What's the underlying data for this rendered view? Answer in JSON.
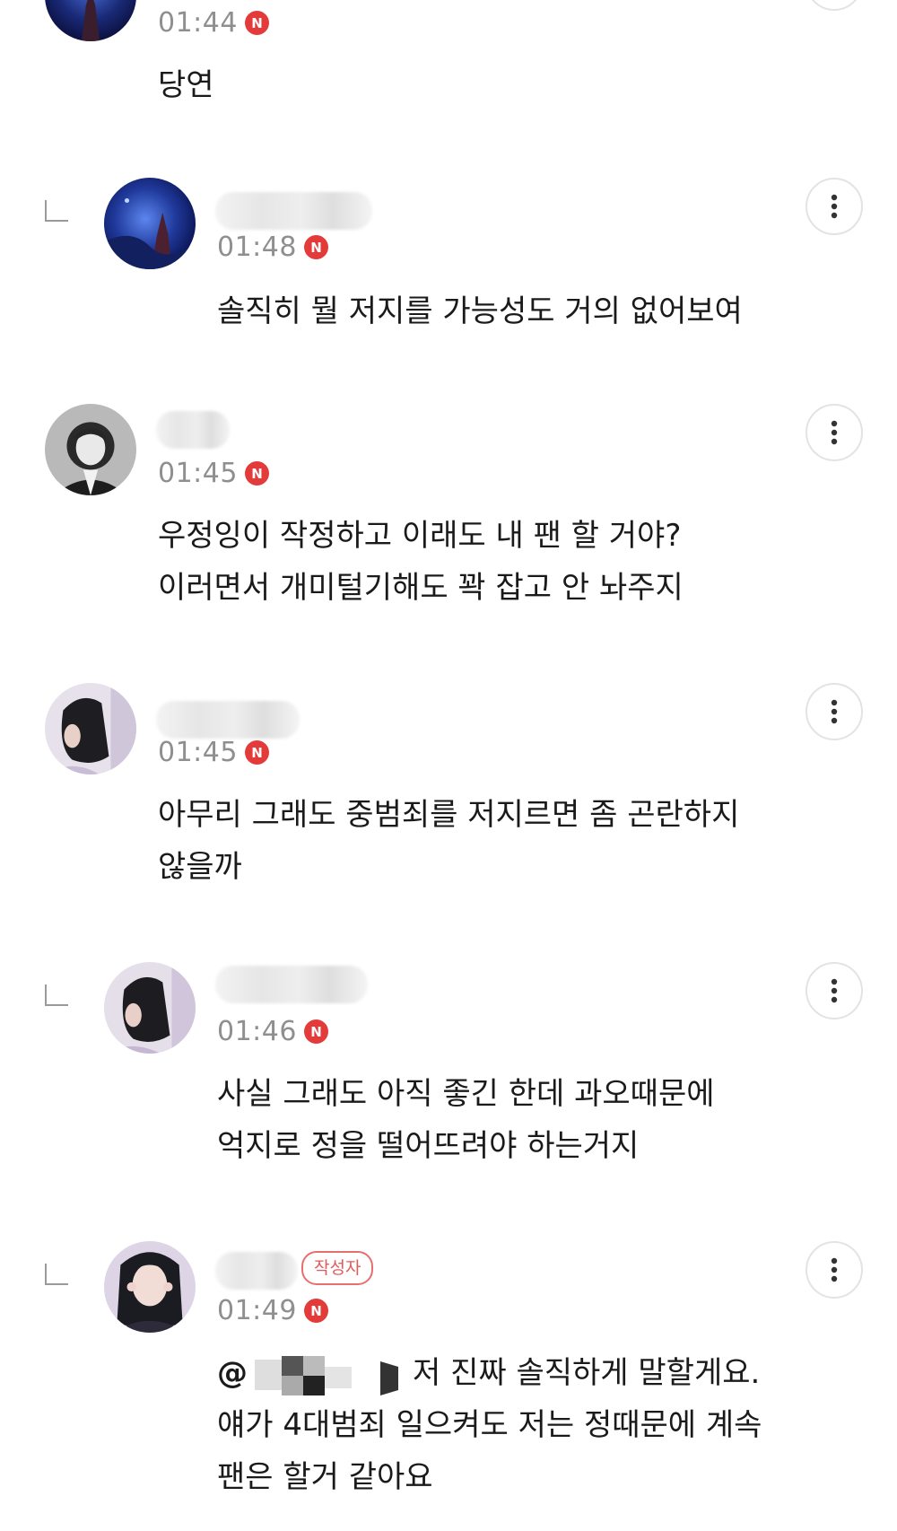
{
  "comments": [
    {
      "time": "01:44",
      "badge": "N",
      "lines": [
        "당연"
      ]
    },
    {
      "time": "01:48",
      "badge": "N",
      "lines": [
        "솔직히 뭘 저지를 가능성도 거의 없어보여"
      ]
    },
    {
      "time": "01:45",
      "badge": "N",
      "lines": [
        "우정잉이 작정하고 이래도 내 팬 할 거야?",
        "이러면서 개미털기해도 꽉 잡고 안 놔주지"
      ]
    },
    {
      "time": "01:45",
      "badge": "N",
      "lines": [
        "아무리 그래도 중범죄를 저지르면 좀 곤란하지",
        "않을까"
      ]
    },
    {
      "time": "01:46",
      "badge": "N",
      "lines": [
        "사실 그래도 아직 좋긴 한데 과오때문에",
        "억지로 정을 떨어뜨려야 하는거지"
      ]
    },
    {
      "time": "01:49",
      "badge": "N",
      "author_label": "작성자",
      "mention": "@",
      "lines": [
        "저 진짜 솔직하게 말할게요.",
        "얘가 4대범죄 일으켜도 저는 정때문에 계속",
        "팬은 할거 같아요"
      ]
    }
  ],
  "colors": {
    "accent": "#e33a3a",
    "time": "#8f8f8f",
    "divider": "#e6e6e6"
  },
  "icons": {
    "more": "more-vertical-icon",
    "reply": "reply-arrow-icon",
    "new": "new-badge-icon"
  }
}
